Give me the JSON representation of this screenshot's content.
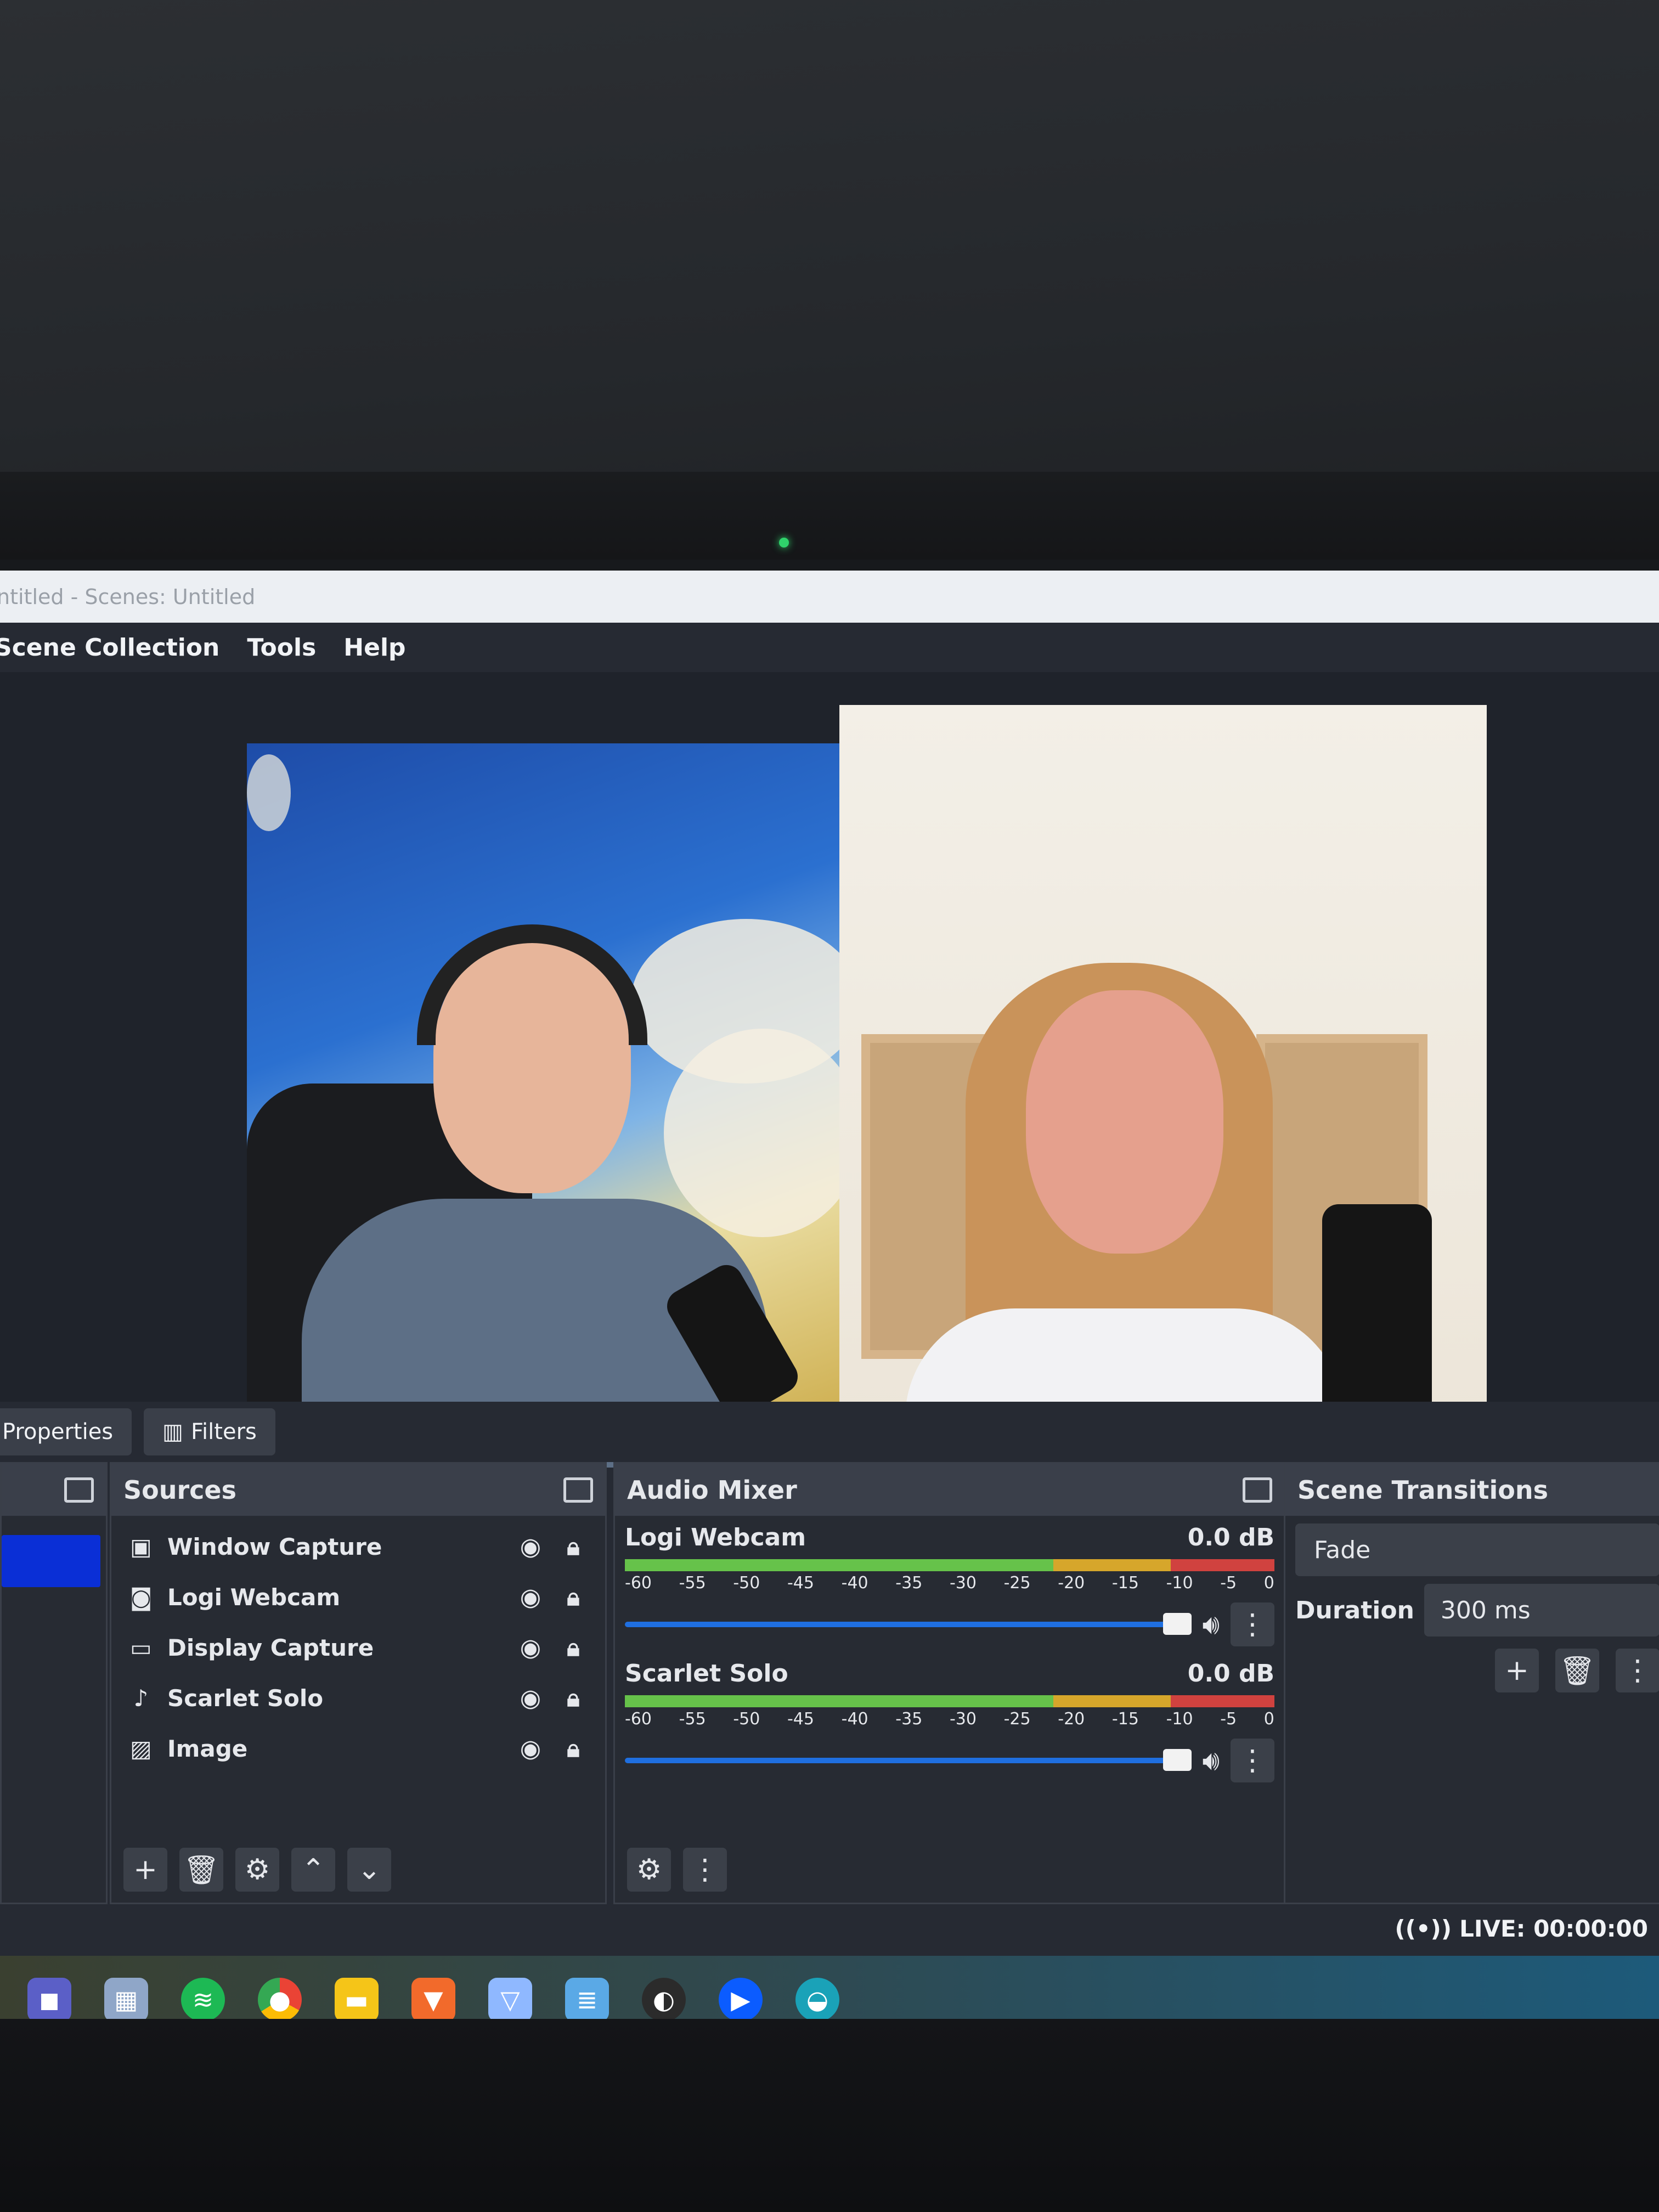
{
  "window": {
    "title": "ntitled - Scenes: Untitled"
  },
  "menu": [
    "Scene Collection",
    "Tools",
    "Help"
  ],
  "dock_tabs": {
    "properties": "Properties",
    "filters": "Filters"
  },
  "sources": {
    "title": "Sources",
    "items": [
      {
        "label": "Window Capture",
        "icon": "window-capture-icon"
      },
      {
        "label": "Logi Webcam",
        "icon": "camera-icon"
      },
      {
        "label": "Display Capture",
        "icon": "monitor-icon"
      },
      {
        "label": "Scarlet Solo",
        "icon": "microphone-icon"
      },
      {
        "label": "Image",
        "icon": "image-icon"
      }
    ]
  },
  "mixer": {
    "title": "Audio Mixer",
    "channels": [
      {
        "name": "Logi Webcam",
        "level": "0.0 dB"
      },
      {
        "name": "Scarlet Solo",
        "level": "0.0 dB"
      }
    ],
    "ticks": [
      "-60",
      "-55",
      "-50",
      "-45",
      "-40",
      "-35",
      "-30",
      "-25",
      "-20",
      "-15",
      "-10",
      "-5",
      "0"
    ]
  },
  "transitions": {
    "title": "Scene Transitions",
    "selected": "Fade",
    "duration_label": "Duration",
    "duration_value": "300 ms"
  },
  "status": {
    "live": "LIVE: 00:00:00"
  },
  "colors": {
    "selection": "#0a2fd6",
    "panel": "#272b33",
    "accent": "#1f6fe0"
  }
}
